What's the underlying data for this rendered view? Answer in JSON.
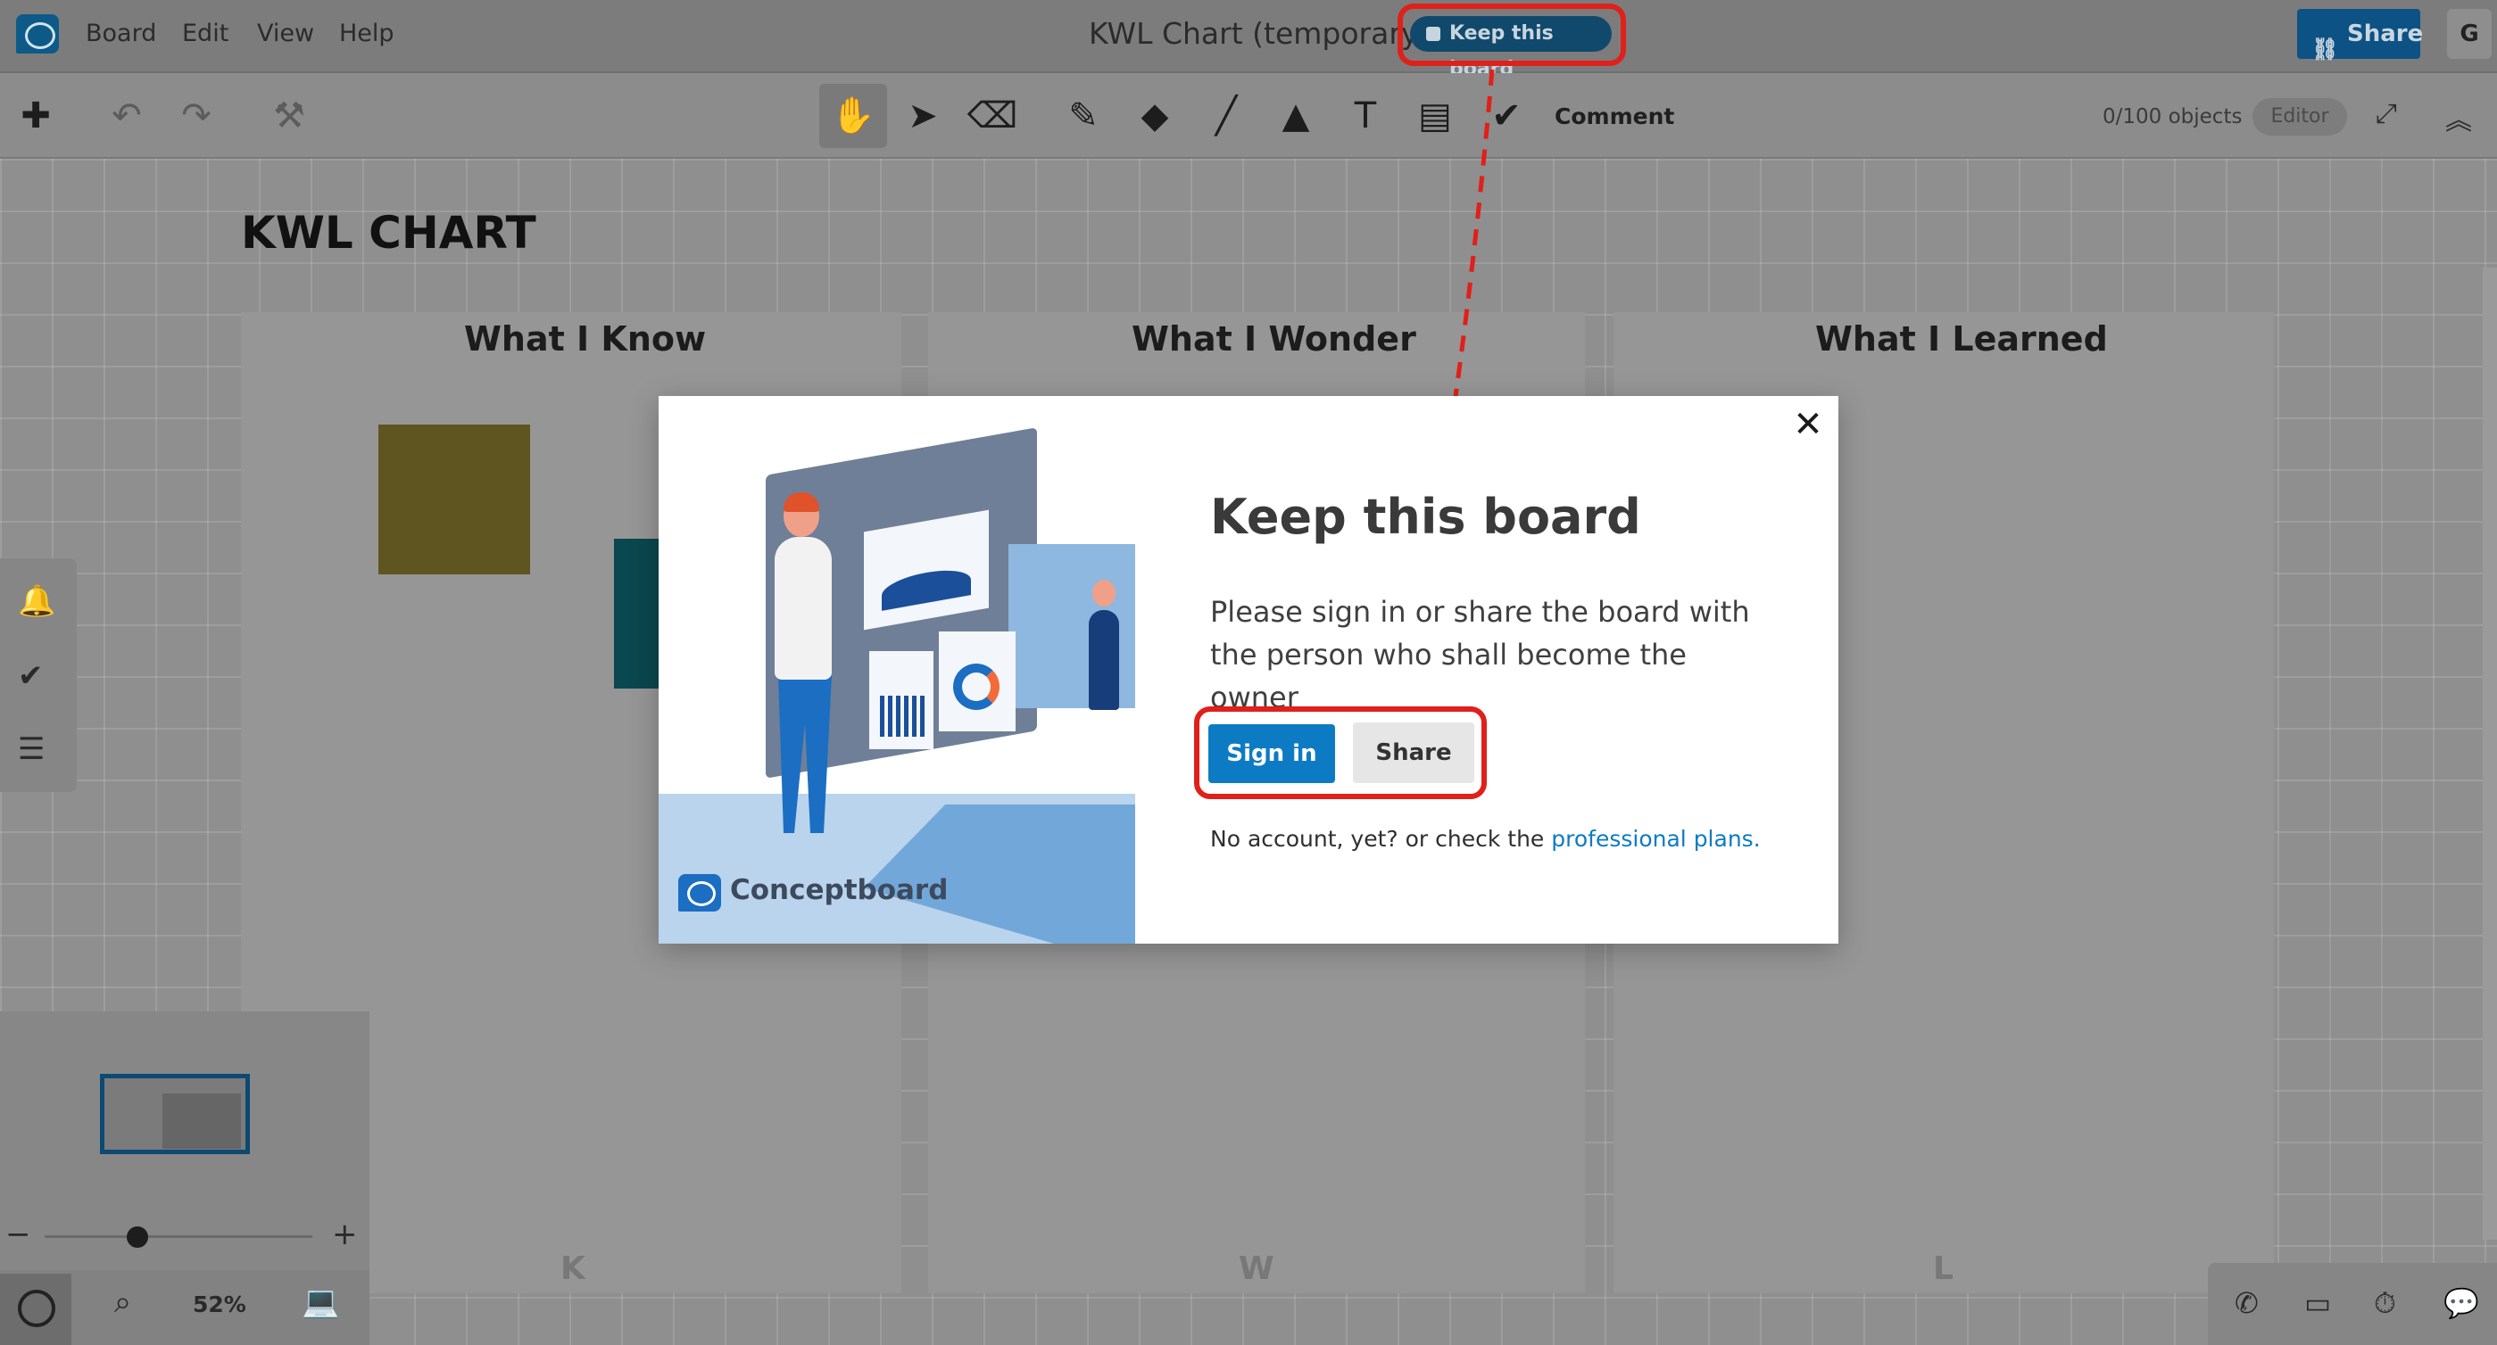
{
  "menubar": {
    "menu_items": [
      "Board",
      "Edit",
      "View",
      "Help"
    ],
    "board_title": "KWL Chart (temporary)",
    "keep_board_label": "Keep this board",
    "share_label": "Share",
    "avatar_initial": "G"
  },
  "toolbar": {
    "comment_label": "Comment",
    "objects_count": "0/100 objects",
    "editor_badge": "Editor",
    "tools": [
      "add",
      "undo",
      "redo",
      "format-painter",
      "hand",
      "select",
      "eraser",
      "pen",
      "highlighter",
      "line",
      "shapes",
      "text",
      "sticky-note",
      "comment"
    ]
  },
  "board": {
    "title": "KWL CHART",
    "columns": [
      {
        "heading": "What I Know",
        "footer": "K"
      },
      {
        "heading": "What I Wonder",
        "footer": "W"
      },
      {
        "heading": "What I Learned",
        "footer": "L"
      }
    ]
  },
  "zoom": {
    "level": "52%",
    "minus": "−",
    "plus": "+"
  },
  "dialog": {
    "title": "Keep this board",
    "body": "Please sign in or share the board with the person who shall become the owner",
    "signin_label": "Sign in",
    "share_label": "Share",
    "footer_prefix": "No account, yet? or check the ",
    "footer_link": "professional plans.",
    "close_symbol": "✕",
    "illustration_brand": "Conceptboard"
  },
  "colors": {
    "accent": "#0d7bc4",
    "highlight": "#e0201a",
    "pill": "#11496d"
  }
}
